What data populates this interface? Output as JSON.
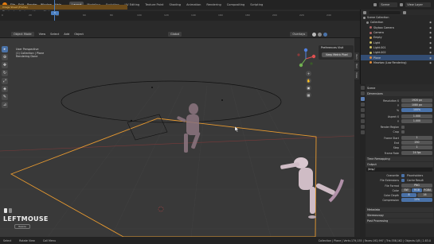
{
  "menubar": {
    "items": [
      "File",
      "Edit",
      "Render",
      "Window",
      "Help"
    ],
    "workspaces": [
      "Layout",
      "Modeling",
      "Sculpting",
      "UV Editing",
      "Texture Paint",
      "Shading",
      "Animation",
      "Rendering",
      "Compositing",
      "Scripting"
    ],
    "active_workspace": "Layout",
    "scene_name": "Scene",
    "view_layer": "View Layer"
  },
  "timeline": {
    "buttons": [
      "Playback",
      "Keying",
      "View",
      "Marker"
    ],
    "current_frame": "1",
    "ticks": [
      "0",
      "20",
      "40",
      "60",
      "80",
      "100",
      "120",
      "140",
      "160",
      "180",
      "200",
      "220",
      "240"
    ],
    "warning": "Image Sheet (Frame)"
  },
  "viewport_header": {
    "mode": "Object Mode",
    "menus": [
      "View",
      "Select",
      "Add",
      "Object"
    ],
    "transform": "Global",
    "overlays_label": "Overlays"
  },
  "viewport": {
    "overlay_lines": [
      "User Perspective",
      "(1) Collection | Plane",
      "Rendering Done"
    ],
    "popup_title": "Preferences Visit",
    "popup_button": "Keep Metric Pixel",
    "last_key": "LEFTMOUSE",
    "last_key_button": "Resize"
  },
  "side_tabs": [
    "Item",
    "Tool",
    "View"
  ],
  "outliner": {
    "header": "Scene Collection",
    "rows": [
      {
        "name": "Collection",
        "color": "#8a8a8a"
      },
      {
        "name": "Skybox Camera",
        "color": "#b06464"
      },
      {
        "name": "Camera",
        "color": "#b06464"
      },
      {
        "name": "Empty",
        "color": "#d0a050"
      },
      {
        "name": "Light",
        "color": "#d0c060"
      },
      {
        "name": "Light.001",
        "color": "#d0c060"
      },
      {
        "name": "Light.002",
        "color": "#d0c060"
      },
      {
        "name": "Plane",
        "color": "#e08a3a"
      },
      {
        "name": "Mewtwo (Low Rendering)",
        "color": "#e08a3a"
      }
    ],
    "selected_index": 7
  },
  "properties": {
    "scene_label": "Scene",
    "section_dimensions": "Dimensions",
    "resolution_label": "Resolution X",
    "resolution_x": "1920 px",
    "resolution_y_label": "Y",
    "resolution_y": "1080 px",
    "percent_label": "%",
    "percent": "100%",
    "aspect_label": "Aspect X",
    "aspect_x": "1.000",
    "aspect_y": "1.000",
    "render_region_label": "Render Region",
    "crop_label": "Crop",
    "frame_start_label": "Frame Start",
    "frame_start": "1",
    "end_label": "End",
    "frame_end": "250",
    "step_label": "Step",
    "frame_step": "1",
    "frame_rate_label": "Frame Rate",
    "frame_rate": "24 fps",
    "section_time_remap": "Time Remapping",
    "section_output": "Output",
    "output_path": "/tmp/",
    "overwrite_label": "Overwrite",
    "file_extensions_label": "File Extensions",
    "placeholders_label": "Placeholders",
    "cache_result_label": "Cache Result",
    "file_format_label": "File Format",
    "file_format": "PNG",
    "color_label": "Color",
    "color_opts": [
      "BW",
      "RGB",
      "RGBA"
    ],
    "color_depth_label": "Color Depth",
    "color_depth": [
      "8",
      "16"
    ],
    "compression_label": "Compression",
    "compression": "15%",
    "section_metadata": "Metadata",
    "section_stereoscopy": "Stereoscopy",
    "section_post": "Post Processing"
  },
  "statusbar": {
    "left": "Select",
    "middle": "Rotate View",
    "right_menu": "Call Menu",
    "stats": "Collection | Plane | Verts:179,155 | Faces:192,997 | Tris:358,162 | Objects:1/8 | 2.83.0"
  }
}
